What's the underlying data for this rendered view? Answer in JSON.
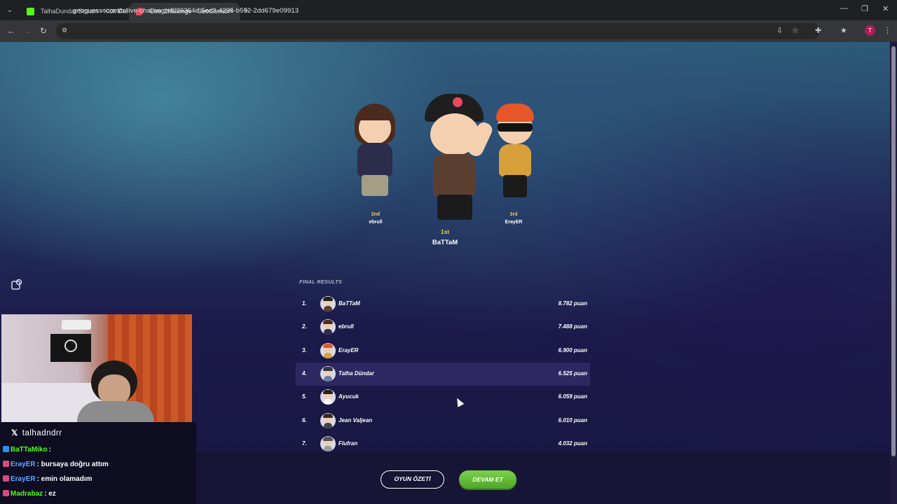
{
  "browser": {
    "tabs": [
      {
        "title": "TalhaDundar Stream - Kick Dash",
        "favicon_color": "#53fc18",
        "active": false
      },
      {
        "title": "Live Challenge - GeoGuessr",
        "favicon_color": "#e84a5f",
        "active": true
      }
    ],
    "url": "geoguessr.com/tr/live-challenge/f026364d-5ee9-4295-b552-2dd679e09913",
    "profile_initial": "T"
  },
  "podium": {
    "first": {
      "place": "1st",
      "name": "BaTTaM"
    },
    "second": {
      "place": "2nd",
      "name": "ebrull"
    },
    "third": {
      "place": "3rd",
      "name": "ErayER"
    }
  },
  "results": {
    "title": "FINAL RESULTS",
    "rows": [
      {
        "rank": "1.",
        "name": "BaTTaM",
        "score": "8.782 puan",
        "hair": "#222222",
        "shirt": "#5a3f31"
      },
      {
        "rank": "2.",
        "name": "ebrull",
        "score": "7.488 puan",
        "hair": "#4b2b1e",
        "shirt": "#2b2d4a"
      },
      {
        "rank": "3.",
        "name": "ErayER",
        "score": "6.900 puan",
        "hair": "#e5562a",
        "shirt": "#d8a03a"
      },
      {
        "rank": "4.",
        "name": "Talha Dündar",
        "score": "6.525 puan",
        "hair": "#30384a",
        "shirt": "#6b7aa1"
      },
      {
        "rank": "5.",
        "name": "Ayucuk",
        "score": "6.059 puan",
        "hair": "#222222",
        "shirt": "#ffffff"
      },
      {
        "rank": "6.",
        "name": "Jean Valjean",
        "score": "6.010 puan",
        "hair": "#3a2a22",
        "shirt": "#444444"
      },
      {
        "rank": "7.",
        "name": "Flufran",
        "score": "4.032 puan",
        "hair": "#555555",
        "shirt": "#9a9aa5"
      }
    ],
    "highlight_index": 3
  },
  "buttons": {
    "summary": "OYUN ÖZETİ",
    "continue": "DEVAM ET"
  },
  "stream": {
    "handle": "talhadndrr",
    "chat": [
      {
        "user": "BaTTaMiko",
        "user_color": "#53fc18",
        "message": ":"
      },
      {
        "user": "ErayER",
        "user_color": "#5fa8ff",
        "message": ": bursaya doğru attım"
      },
      {
        "user": "ErayER",
        "user_color": "#5fa8ff",
        "message": ": emin olamadım"
      },
      {
        "user": "Madrabaz",
        "user_color": "#53fc18",
        "message": ": ez"
      }
    ]
  }
}
